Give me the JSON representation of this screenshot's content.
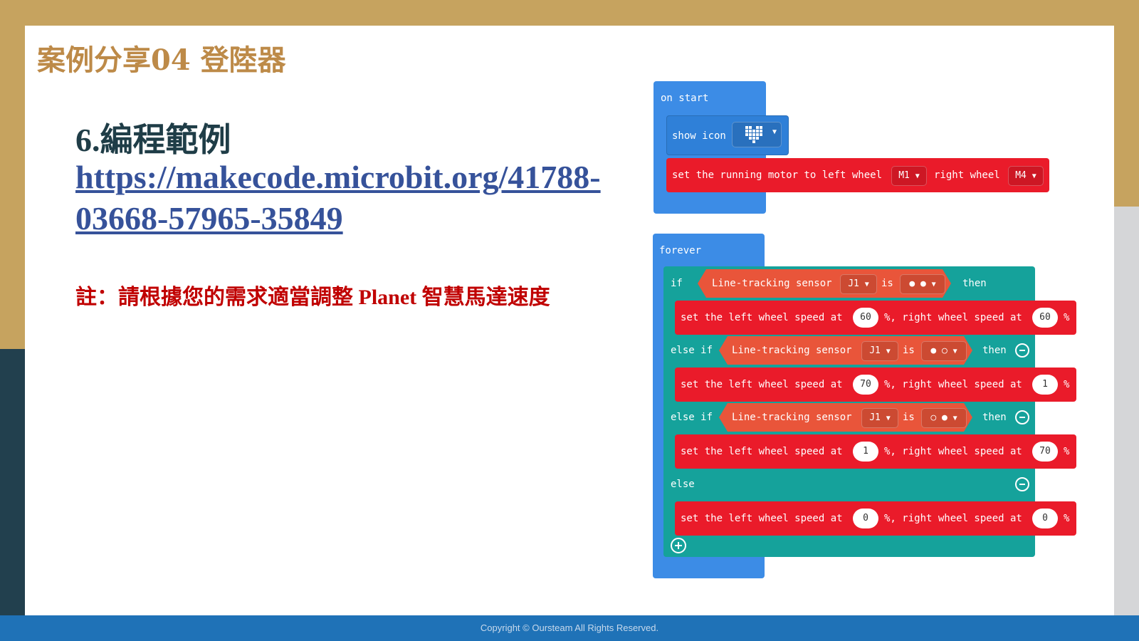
{
  "slide": {
    "title": "案例分享04 登陸器",
    "heading": "6.編程範例",
    "link": "https://makecode.microbit.org/41788-03668-57965-35849",
    "note": "註：請根據您的需求適當調整 Planet 智慧馬達速度",
    "footer": "Copyright © Oursteam All Rights Reserved."
  },
  "blocks": {
    "on_start": {
      "label": "on start",
      "show_icon": "show icon",
      "icon": "heart-icon",
      "motor_text": "set the running motor to left wheel",
      "left_value": "M1",
      "right_text": "right wheel",
      "right_value": "M4"
    },
    "forever": {
      "label": "forever",
      "if": "if",
      "else_if": "else if",
      "else": "else",
      "then": "then",
      "sensor": "Line-tracking sensor",
      "port": "J1",
      "is": "is",
      "state_1": "● ●",
      "state_2": "● ○",
      "state_3": "○ ●",
      "set_left": "set the left wheel speed at",
      "set_right": "%, right wheel speed at",
      "pct": "%",
      "speeds": [
        {
          "left": "60",
          "right": "60"
        },
        {
          "left": "70",
          "right": "1"
        },
        {
          "left": "1",
          "right": "70"
        },
        {
          "left": "0",
          "right": "0"
        }
      ]
    }
  }
}
